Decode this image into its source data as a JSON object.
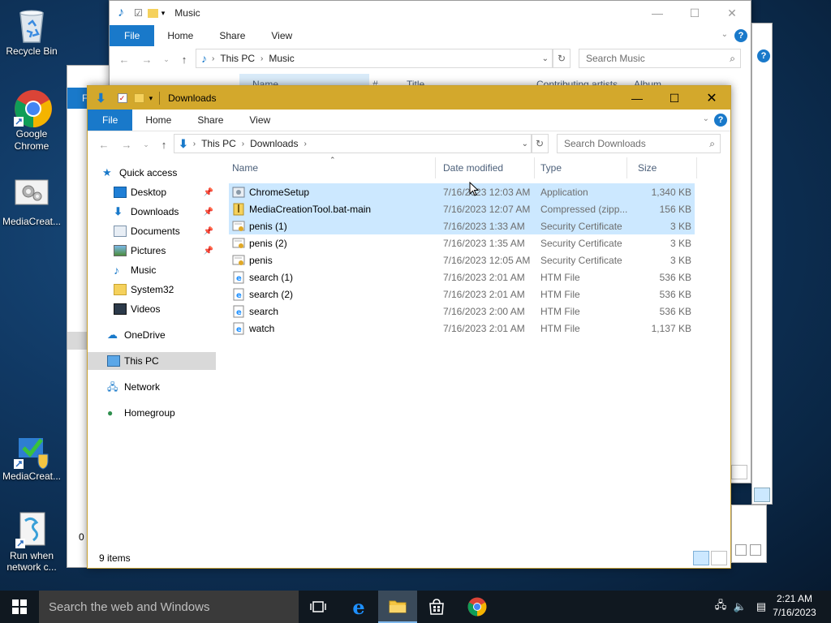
{
  "desktop": {
    "icons": [
      {
        "label": "Recycle Bin"
      },
      {
        "label": "Google Chrome"
      },
      {
        "label": "MediaCreat..."
      },
      {
        "label": "MediaCreat..."
      },
      {
        "label": "Run when network c..."
      }
    ]
  },
  "music_window": {
    "title": "Music",
    "tabs": [
      "File",
      "Home",
      "Share",
      "View"
    ],
    "address": [
      "This PC",
      "Music"
    ],
    "search_placeholder": "Search Music",
    "columns": [
      "Name",
      "#",
      "Title",
      "Contributing artists",
      "Album"
    ]
  },
  "back_window": {
    "tab_file": "F",
    "status_count": "0 i"
  },
  "downloads_window": {
    "title": "Downloads",
    "tabs": [
      "File",
      "Home",
      "Share",
      "View"
    ],
    "address": [
      "This PC",
      "Downloads"
    ],
    "search_placeholder": "Search Downloads",
    "nav": {
      "quick_access": "Quick access",
      "items": [
        "Desktop",
        "Downloads",
        "Documents",
        "Pictures",
        "Music",
        "System32",
        "Videos"
      ],
      "onedrive": "OneDrive",
      "this_pc": "This PC",
      "network": "Network",
      "homegroup": "Homegroup"
    },
    "columns": {
      "name": "Name",
      "date": "Date modified",
      "type": "Type",
      "size": "Size"
    },
    "files": [
      {
        "name": "ChromeSetup",
        "date": "7/16/2023 12:03 AM",
        "type": "Application",
        "size": "1,340 KB",
        "icon": "app-icon",
        "selected": true
      },
      {
        "name": "MediaCreationTool.bat-main",
        "date": "7/16/2023 12:07 AM",
        "type": "Compressed (zipp...",
        "size": "156 KB",
        "icon": "zip-icon",
        "selected": true
      },
      {
        "name": "penis (1)",
        "date": "7/16/2023 1:33 AM",
        "type": "Security Certificate",
        "size": "3 KB",
        "icon": "certificate-icon",
        "selected": true
      },
      {
        "name": "penis (2)",
        "date": "7/16/2023 1:35 AM",
        "type": "Security Certificate",
        "size": "3 KB",
        "icon": "certificate-icon",
        "selected": false
      },
      {
        "name": "penis",
        "date": "7/16/2023 12:05 AM",
        "type": "Security Certificate",
        "size": "3 KB",
        "icon": "certificate-icon",
        "selected": false
      },
      {
        "name": "search (1)",
        "date": "7/16/2023 2:01 AM",
        "type": "HTM File",
        "size": "536 KB",
        "icon": "htm-icon",
        "selected": false
      },
      {
        "name": "search (2)",
        "date": "7/16/2023 2:01 AM",
        "type": "HTM File",
        "size": "536 KB",
        "icon": "htm-icon",
        "selected": false
      },
      {
        "name": "search",
        "date": "7/16/2023 2:00 AM",
        "type": "HTM File",
        "size": "536 KB",
        "icon": "htm-icon",
        "selected": false
      },
      {
        "name": "watch",
        "date": "7/16/2023 2:01 AM",
        "type": "HTM File",
        "size": "1,137 KB",
        "icon": "htm-icon",
        "selected": false
      }
    ],
    "status": "9 items"
  },
  "taskbar": {
    "search_placeholder": "Search the web and Windows",
    "time": "2:21 AM",
    "date": "7/16/2023"
  },
  "colors": {
    "accent": "#1979ca",
    "active_title": "#d3a82c",
    "selection": "#cce8ff",
    "taskbar": "#101820"
  }
}
